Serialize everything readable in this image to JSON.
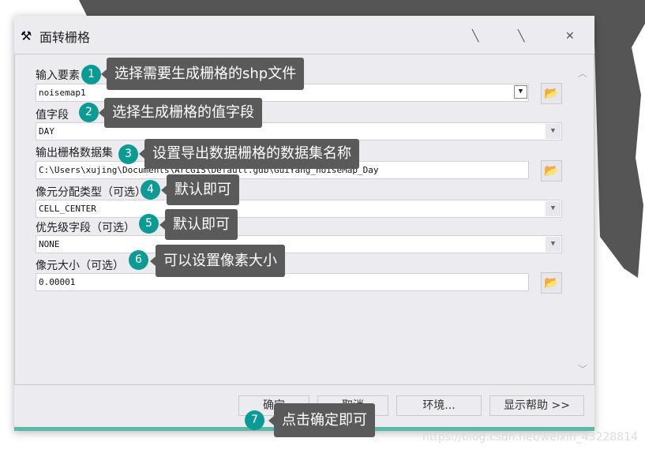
{
  "dialog": {
    "title": "面转栅格",
    "icon": "hammer-icon",
    "title_buttons": [
      "pin-icon",
      "minimize-icon",
      "close-icon"
    ]
  },
  "fields": [
    {
      "label": "输入要素",
      "value": "noisemap1",
      "type": "combo-browse"
    },
    {
      "label": "值字段",
      "value": "DAY",
      "type": "dropdown"
    },
    {
      "label": "输出栅格数据集",
      "value": "C:\\Users\\xujing\\Documents\\ArcGIS\\Default.gdb\\GuiYang_noiseMap_Day",
      "type": "browse"
    },
    {
      "label": "像元分配类型（可选）",
      "value": "CELL_CENTER",
      "type": "dropdown"
    },
    {
      "label": "优先级字段（可选）",
      "value": "NONE",
      "type": "dropdown"
    },
    {
      "label": "像元大小（可选）",
      "value": "0.00001",
      "type": "browse"
    }
  ],
  "buttons": {
    "ok": "确定",
    "cancel": "取消",
    "env": "环境...",
    "help": "显示帮助 >>"
  },
  "callouts": [
    {
      "n": "1",
      "text": "选择需要生成栅格的shp文件"
    },
    {
      "n": "2",
      "text": "选择生成栅格的值字段"
    },
    {
      "n": "3",
      "text": "设置导出数据栅格的数据集名称"
    },
    {
      "n": "4",
      "text": "默认即可"
    },
    {
      "n": "5",
      "text": "默认即可"
    },
    {
      "n": "6",
      "text": "可以设置像素大小"
    },
    {
      "n": "7",
      "text": "点击确定即可"
    }
  ],
  "watermark": "https://blog.csdn.net/weixin_43228814",
  "colors": {
    "callout_circle": "#0e9a94",
    "callout_box": "#5a5a5a",
    "accent_bar": "#5cb8a8"
  }
}
